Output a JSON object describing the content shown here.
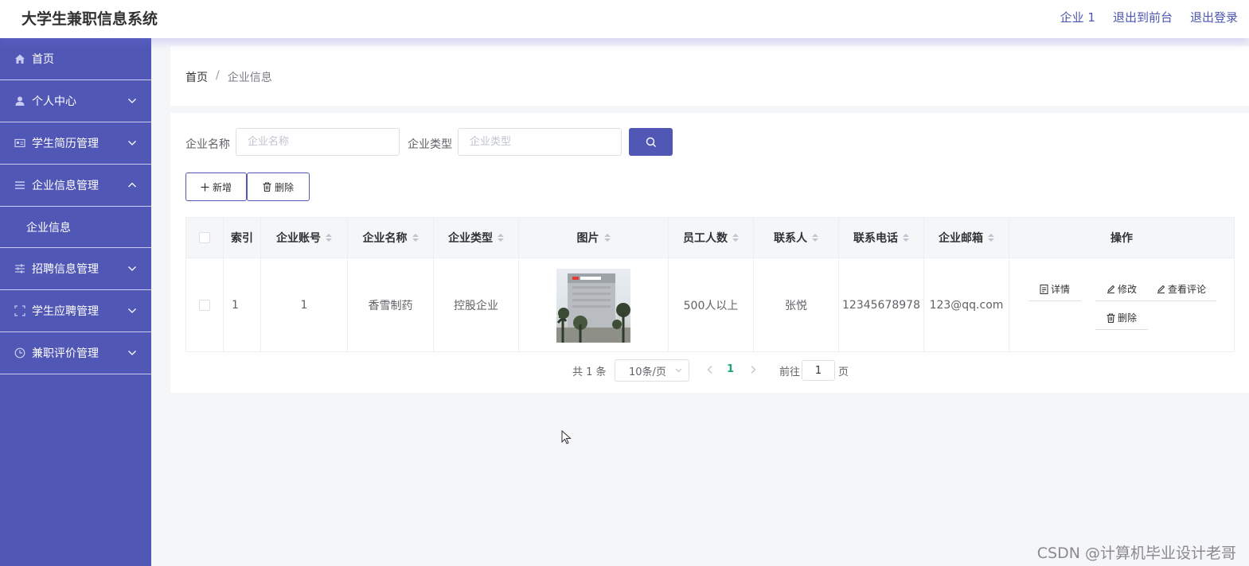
{
  "header": {
    "title": "大学生兼职信息系统",
    "user": "企业 1",
    "back_to_front": "退出到前台",
    "logout": "退出登录"
  },
  "sidebar": {
    "items": [
      {
        "label": "首页",
        "icon": "home-icon"
      },
      {
        "label": "个人中心",
        "icon": "user-icon"
      },
      {
        "label": "学生简历管理",
        "icon": "id-card-icon"
      },
      {
        "label": "企业信息管理",
        "icon": "list-icon",
        "expanded": true,
        "children": [
          "企业信息"
        ]
      },
      {
        "label": "招聘信息管理",
        "icon": "sliders-icon"
      },
      {
        "label": "学生应聘管理",
        "icon": "frame-icon"
      },
      {
        "label": "兼职评价管理",
        "icon": "clock-icon"
      }
    ],
    "bg_color": "#5057b5"
  },
  "breadcrumb": {
    "home": "首页",
    "separator": "/",
    "current": "企业信息"
  },
  "search": {
    "name_label": "企业名称",
    "name_placeholder": "企业名称",
    "type_label": "企业类型",
    "type_placeholder": "企业类型"
  },
  "toolbar": {
    "add_label": "新增",
    "delete_label": "删除"
  },
  "table": {
    "columns": [
      "索引",
      "企业账号",
      "企业名称",
      "企业类型",
      "图片",
      "员工人数",
      "联系人",
      "联系电话",
      "企业邮箱",
      "操作"
    ],
    "rows": [
      {
        "index": "1",
        "account": "1",
        "name": "香雪制药",
        "type": "控股企业",
        "employees": "500人以上",
        "contact": "张悦",
        "phone": "12345678978",
        "email": "123@qq.com"
      }
    ],
    "actions": {
      "detail": "详情",
      "edit": "修改",
      "view_comments": "查看评论",
      "delete": "删除"
    }
  },
  "pagination": {
    "total": "共 1 条",
    "page_size": "10条/页",
    "current_page": "1",
    "goto_label": "前往",
    "goto_value": "1",
    "page_suffix": "页"
  },
  "watermark": "CSDN @计算机毕业设计老哥",
  "colors": {
    "accent": "#5057b5",
    "active_page": "#19a974"
  }
}
